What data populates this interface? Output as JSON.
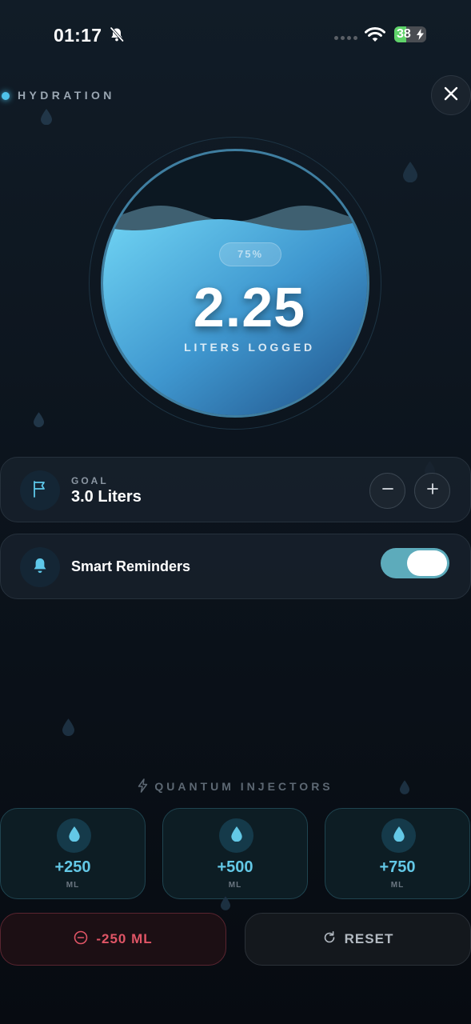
{
  "status_bar": {
    "time": "01:17",
    "battery": "38",
    "battery_level": 0.38,
    "icons": [
      "bell-slash-icon",
      "cellular-signal-icon",
      "wifi-icon",
      "battery-charging-icon"
    ]
  },
  "header": {
    "title": "HYDRATION",
    "close_icon": "close-icon"
  },
  "gauge": {
    "percent_label": "75%",
    "fill_fraction": 0.75,
    "value": "2.25",
    "label": "LITERS LOGGED"
  },
  "goal": {
    "icon": "flag-icon",
    "label": "GOAL",
    "value": "3.0 Liters",
    "minus_icon": "minus-icon",
    "plus_icon": "plus-icon"
  },
  "reminders": {
    "icon": "bell-icon",
    "label": "Smart Reminders",
    "enabled": true
  },
  "injectors": {
    "title": "QUANTUM INJECTORS",
    "title_icon": "lightning-icon",
    "items": [
      {
        "amount": "+250",
        "unit": "ML",
        "icon": "water-drop-icon"
      },
      {
        "amount": "+500",
        "unit": "ML",
        "icon": "water-drop-icon"
      },
      {
        "amount": "+750",
        "unit": "ML",
        "icon": "water-drop-icon"
      }
    ]
  },
  "actions": {
    "minus_label": "-250 ML",
    "minus_icon": "minus-circle-icon",
    "reset_label": "RESET",
    "reset_icon": "refresh-icon"
  },
  "colors": {
    "accent": "#4fc3ea",
    "danger": "#e05566",
    "toggle_on": "#5dabbb",
    "background": "#0c141d"
  }
}
